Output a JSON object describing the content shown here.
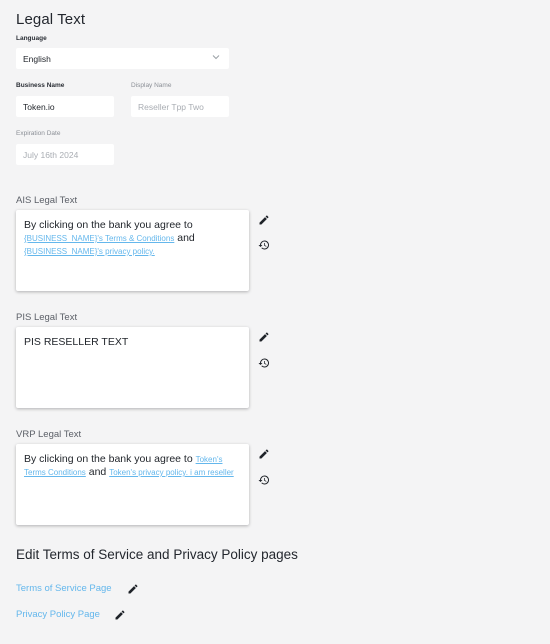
{
  "header": {
    "title": "Legal Text"
  },
  "language": {
    "label": "Language",
    "value": "English"
  },
  "business_name": {
    "label": "Business Name",
    "value": "Token.io"
  },
  "display_name": {
    "label": "Display Name",
    "placeholder": "Reseller Tpp Two"
  },
  "expiration_date": {
    "label": "Expiration Date",
    "placeholder": "July 16th 2024"
  },
  "ais": {
    "label": "AIS Legal Text",
    "text_prefix": "By clicking on the bank you agree to",
    "link1": "{BUSINESS_NAME}'s Terms & Conditions",
    "and": "and",
    "link2": "{BUSINESS_NAME}'s privacy policy."
  },
  "pis": {
    "label": "PIS Legal Text",
    "text": "PIS RESELLER TEXT"
  },
  "vrp": {
    "label": "VRP Legal Text",
    "text_prefix": "By clicking on the bank you agree to",
    "link1": "Token's Terms Conditions",
    "and": "and",
    "link2": "Token's privacy policy. i am reseller"
  },
  "pages_section": {
    "title": "Edit Terms of Service and Privacy Policy pages",
    "tos_link": "Terms of Service Page",
    "privacy_link": "Privacy Policy Page"
  },
  "icons": {
    "edit": "pencil-icon",
    "restore": "history-icon",
    "dropdown": "chevron-down-icon"
  },
  "colors": {
    "background": "#f4f4f5",
    "link": "#64b7ec",
    "text": "#1f2329"
  }
}
